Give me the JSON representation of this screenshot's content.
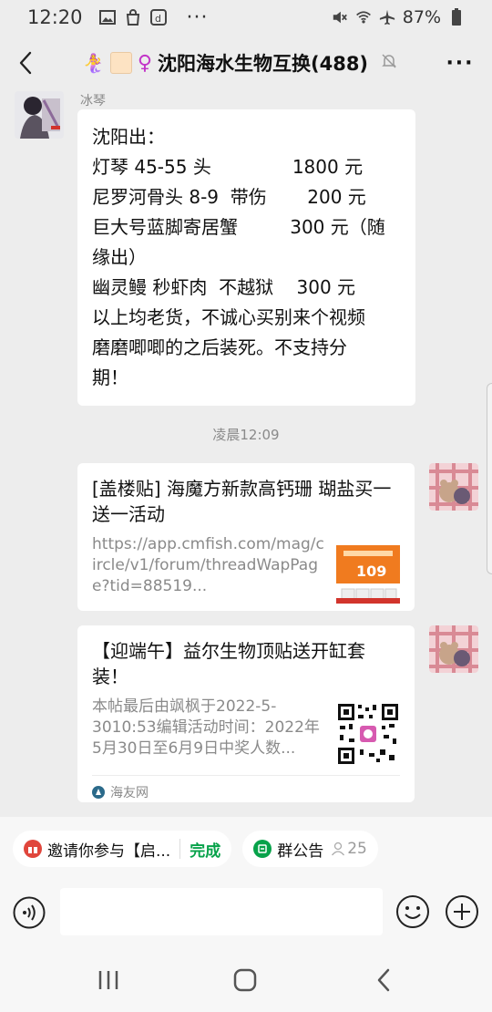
{
  "status_bar": {
    "time": "12:20",
    "dots": "···",
    "battery": "87%"
  },
  "header": {
    "emoji": "🧜‍♀️",
    "female_symbol": "♀",
    "title": "沈阳海水生物互换(488)",
    "more": "···"
  },
  "messages": [
    {
      "sender": "冰琴",
      "lines": [
        "沈阳出：",
        "灯琴 45-55 头              1800 元",
        "尼罗河骨头 8-9  带伤       200 元",
        "巨大号蓝脚寄居蟹         300 元（随",
        "缘出）",
        "幽灵鳗 秒虾肉  不越狱    300 元",
        "以上均老货，不诚心买别来个视频",
        "磨磨唧唧的之后装死。不支持分",
        "期！"
      ]
    }
  ],
  "timestamp": "凌晨12:09",
  "cards": [
    {
      "title": "[盖楼贴] 海魔方新款高钙珊 瑚盐买一送一活动",
      "desc": "https://app.cmfish.com/mag/circle/v1/forum/threadWapPage?tid=88519...",
      "thumb_text": "109"
    },
    {
      "title": "【迎端午】益尔生物顶贴送开缸套装！",
      "desc": "本帖最后由飒枫于2022-5-3010:53编辑活动时间：2022年5月30日至6月9日中奖人数...",
      "source": "海友网"
    }
  ],
  "quickbar": {
    "invite_text": "邀请你参与【启...",
    "invite_done": "完成",
    "notice_text": "群公告",
    "notice_count": "25"
  },
  "input": {
    "placeholder": ""
  },
  "colors": {
    "background": "#ededed",
    "bubble": "#ffffff",
    "accent_green": "#07a24a"
  }
}
